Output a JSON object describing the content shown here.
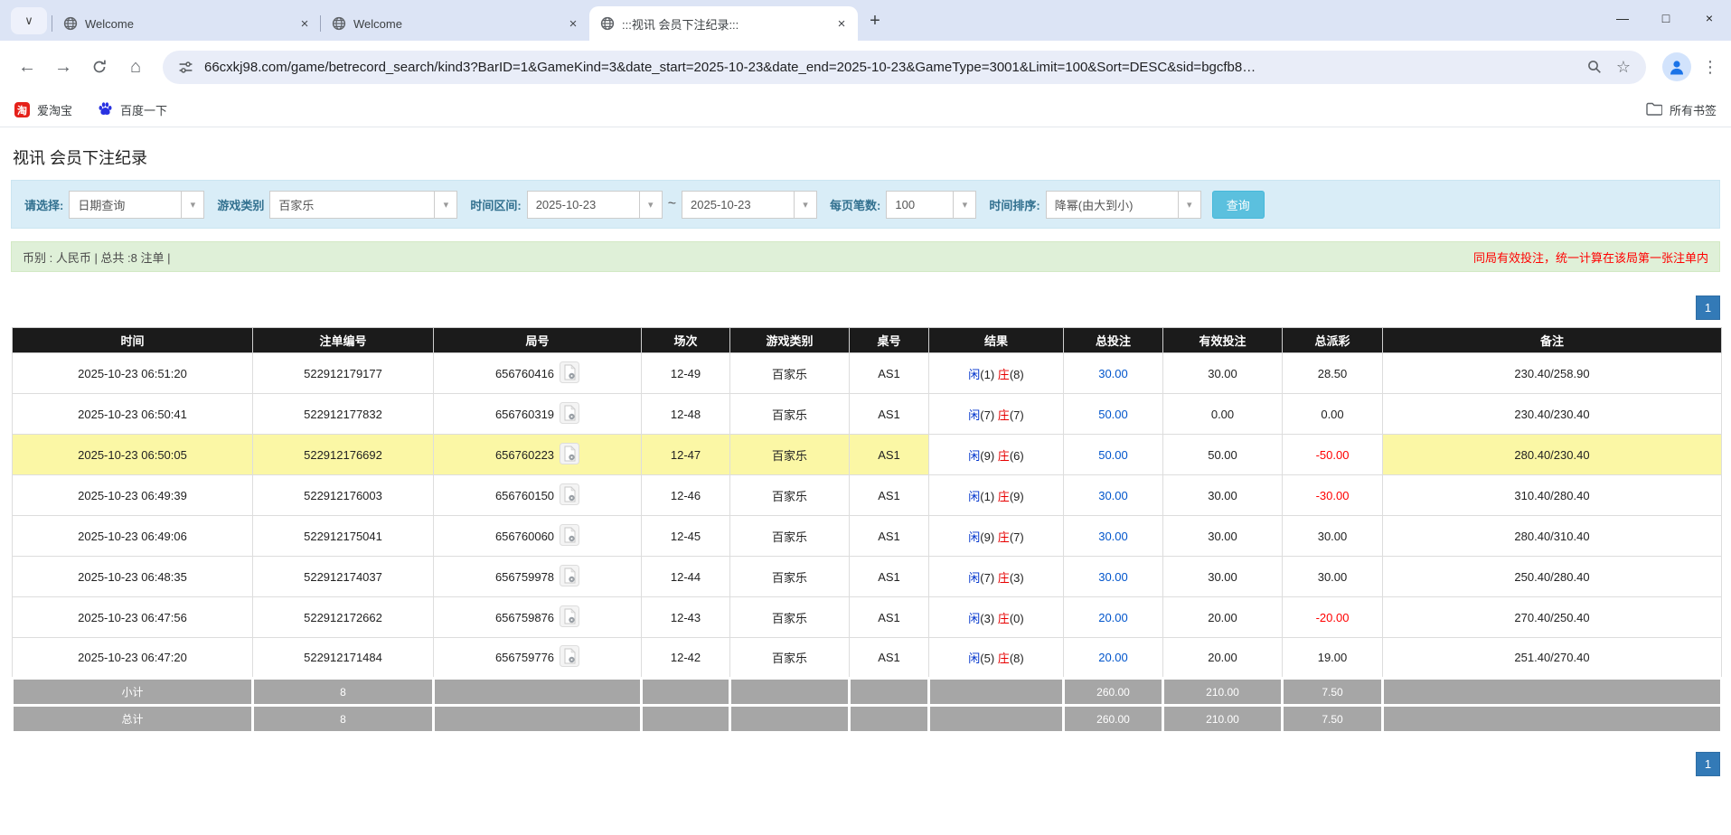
{
  "colors": {
    "accent_blue": "#337ab7",
    "link_blue": "#0055cc",
    "player_blue": "#0033cc",
    "banker_red": "#e60000",
    "negative_red": "#ff0000",
    "highlight_yellow": "#fbf7a5",
    "header_black": "#1b1b1b",
    "filter_blue_bg": "#d9edf7",
    "info_green_bg": "#dff0d8",
    "button_cyan": "#5bc0de"
  },
  "icons": {
    "back": "←",
    "forward": "→",
    "home": "⌂",
    "star": "☆",
    "kebab": "⋮",
    "minimize": "—",
    "maximize": "□",
    "close": "×",
    "new_tab": "+",
    "tab_chevron": "∨",
    "select_arrow": "▾"
  },
  "browser": {
    "tabs": [
      {
        "title": "Welcome"
      },
      {
        "title": "Welcome"
      },
      {
        "title": ":::视讯 会员下注纪录:::"
      }
    ],
    "url": "66cxkj98.com/game/betrecord_search/kind3?BarID=1&GameKind=3&date_start=2025-10-23&date_end=2025-10-23&GameType=3001&Limit=100&Sort=DESC&sid=bgcfb8…",
    "bookmarks": [
      {
        "label": "爱淘宝",
        "badge": "淘"
      },
      {
        "label": "百度一下"
      }
    ],
    "bookmarks_all": "所有书签"
  },
  "page": {
    "title": "视讯 会员下注纪录",
    "filter": {
      "select_label": "请选择:",
      "select_value": "日期查询",
      "game_type_label": "游戏类别",
      "game_type_value": "百家乐",
      "time_range_label": "时间区间:",
      "date_start": "2025-10-23",
      "tilde": "~",
      "date_end": "2025-10-23",
      "per_page_label": "每页笔数:",
      "per_page_value": "100",
      "sort_label": "时间排序:",
      "sort_value": "降幂(由大到小)",
      "search_button": "查询"
    },
    "info_bar": {
      "left": "币别 : 人民币 | 总共 :8 注单 |",
      "right": "同局有效投注，统一计算在该局第一张注单内"
    },
    "pagination": "1",
    "table": {
      "headers": [
        "时间",
        "注单编号",
        "局号",
        "场次",
        "游戏类别",
        "桌号",
        "结果",
        "总投注",
        "有效投注",
        "总派彩",
        "备注"
      ],
      "rows": [
        {
          "time": "2025-10-23 06:51:20",
          "bet_id": "522912179177",
          "round_id": "656760416",
          "session": "12-49",
          "game": "百家乐",
          "table_no": "AS1",
          "result": {
            "player": "闲",
            "player_score": "(1)",
            "banker": "庄",
            "banker_score": "(8)"
          },
          "total_bet": "30.00",
          "valid_bet": "30.00",
          "payout": "28.50",
          "note": "230.40/258.90",
          "highlight": false
        },
        {
          "time": "2025-10-23 06:50:41",
          "bet_id": "522912177832",
          "round_id": "656760319",
          "session": "12-48",
          "game": "百家乐",
          "table_no": "AS1",
          "result": {
            "player": "闲",
            "player_score": "(7)",
            "banker": "庄",
            "banker_score": "(7)"
          },
          "total_bet": "50.00",
          "valid_bet": "0.00",
          "payout": "0.00",
          "note": "230.40/230.40",
          "highlight": false
        },
        {
          "time": "2025-10-23 06:50:05",
          "bet_id": "522912176692",
          "round_id": "656760223",
          "session": "12-47",
          "game": "百家乐",
          "table_no": "AS1",
          "result": {
            "player": "闲",
            "player_score": "(9)",
            "banker": "庄",
            "banker_score": "(6)"
          },
          "total_bet": "50.00",
          "valid_bet": "50.00",
          "payout": "-50.00",
          "note": "280.40/230.40",
          "highlight": true
        },
        {
          "time": "2025-10-23 06:49:39",
          "bet_id": "522912176003",
          "round_id": "656760150",
          "session": "12-46",
          "game": "百家乐",
          "table_no": "AS1",
          "result": {
            "player": "闲",
            "player_score": "(1)",
            "banker": "庄",
            "banker_score": "(9)"
          },
          "total_bet": "30.00",
          "valid_bet": "30.00",
          "payout": "-30.00",
          "note": "310.40/280.40",
          "highlight": false
        },
        {
          "time": "2025-10-23 06:49:06",
          "bet_id": "522912175041",
          "round_id": "656760060",
          "session": "12-45",
          "game": "百家乐",
          "table_no": "AS1",
          "result": {
            "player": "闲",
            "player_score": "(9)",
            "banker": "庄",
            "banker_score": "(7)"
          },
          "total_bet": "30.00",
          "valid_bet": "30.00",
          "payout": "30.00",
          "note": "280.40/310.40",
          "highlight": false
        },
        {
          "time": "2025-10-23 06:48:35",
          "bet_id": "522912174037",
          "round_id": "656759978",
          "session": "12-44",
          "game": "百家乐",
          "table_no": "AS1",
          "result": {
            "player": "闲",
            "player_score": "(7)",
            "banker": "庄",
            "banker_score": "(3)"
          },
          "total_bet": "30.00",
          "valid_bet": "30.00",
          "payout": "30.00",
          "note": "250.40/280.40",
          "highlight": false
        },
        {
          "time": "2025-10-23 06:47:56",
          "bet_id": "522912172662",
          "round_id": "656759876",
          "session": "12-43",
          "game": "百家乐",
          "table_no": "AS1",
          "result": {
            "player": "闲",
            "player_score": "(3)",
            "banker": "庄",
            "banker_score": "(0)"
          },
          "total_bet": "20.00",
          "valid_bet": "20.00",
          "payout": "-20.00",
          "note": "270.40/250.40",
          "highlight": false
        },
        {
          "time": "2025-10-23 06:47:20",
          "bet_id": "522912171484",
          "round_id": "656759776",
          "session": "12-42",
          "game": "百家乐",
          "table_no": "AS1",
          "result": {
            "player": "闲",
            "player_score": "(5)",
            "banker": "庄",
            "banker_score": "(8)"
          },
          "total_bet": "20.00",
          "valid_bet": "20.00",
          "payout": "19.00",
          "note": "251.40/270.40",
          "highlight": false
        }
      ],
      "footer": [
        {
          "label": "小计",
          "count": "8",
          "total_bet": "260.00",
          "valid_bet": "210.00",
          "payout": "7.50"
        },
        {
          "label": "总计",
          "count": "8",
          "total_bet": "260.00",
          "valid_bet": "210.00",
          "payout": "7.50"
        }
      ]
    }
  }
}
